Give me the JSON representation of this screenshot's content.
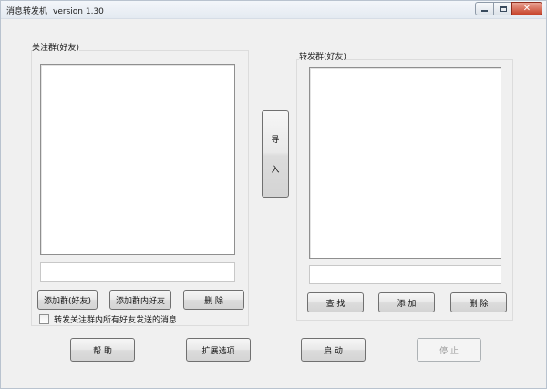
{
  "window": {
    "title_app": "消息转发机",
    "title_version": "version 1.30",
    "minimize_glyph": "▁",
    "close_glyph": "✕"
  },
  "left_panel": {
    "label": "关注群(好友)",
    "input_value": "",
    "buttons": {
      "add_group": "添加群(好友)",
      "add_member": "添加群内好友",
      "delete": "删 除"
    },
    "checkbox_label": "转发关注群内所有好友发送的消息",
    "checkbox_checked": false
  },
  "import_button": {
    "line1": "导",
    "line2": "入"
  },
  "right_panel": {
    "label": "转发群(好友)",
    "input_value": "",
    "buttons": {
      "find": "查 找",
      "add": "添 加",
      "delete": "删 除"
    }
  },
  "bottom": {
    "help": "帮 助",
    "options": "扩展选项",
    "start": "启 动",
    "stop": "停 止",
    "stop_enabled": false
  },
  "colors": {
    "window_bg": "#f0f0f0",
    "close_button": "#c7432b",
    "disabled_text": "#9a9a9a"
  }
}
